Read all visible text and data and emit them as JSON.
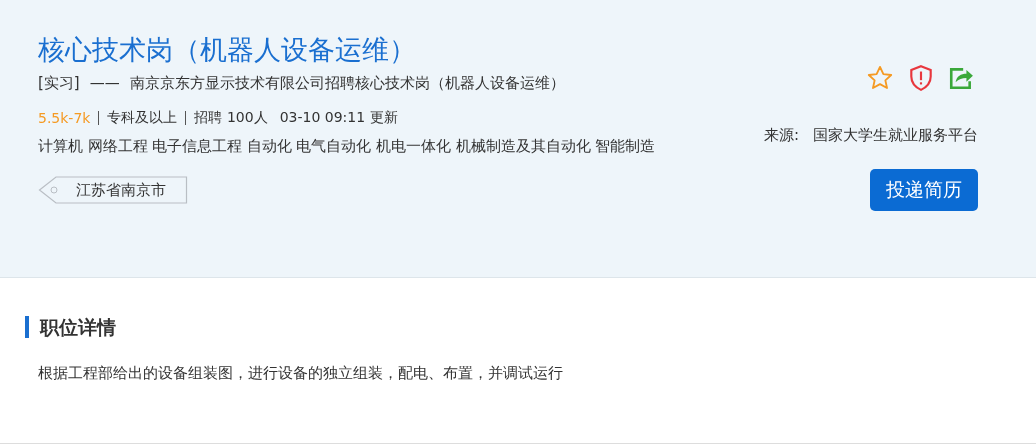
{
  "job": {
    "title": "核心技术岗（机器人设备运维）",
    "type": "[实习]",
    "dash": "——",
    "subtitle": "南京京东方显示技术有限公司招聘核心技术岗（机器人设备运维）",
    "salary": "5.5k-7k",
    "education": "专科及以上",
    "headcount": "招聘 100人",
    "updated": "03-10 09:11 更新",
    "majors": "计算机 网络工程 电子信息工程 自动化 电气自动化 机电一体化 机械制造及其自动化 智能制造",
    "location": "江苏省南京市",
    "source_label": "来源:",
    "source": "国家大学生就业服务平台",
    "apply_button": "投递简历"
  },
  "details": {
    "heading": "职位详情",
    "description": "根据工程部给出的设备组装图，进行设备的独立组装，配电、布置，并调试运行"
  }
}
